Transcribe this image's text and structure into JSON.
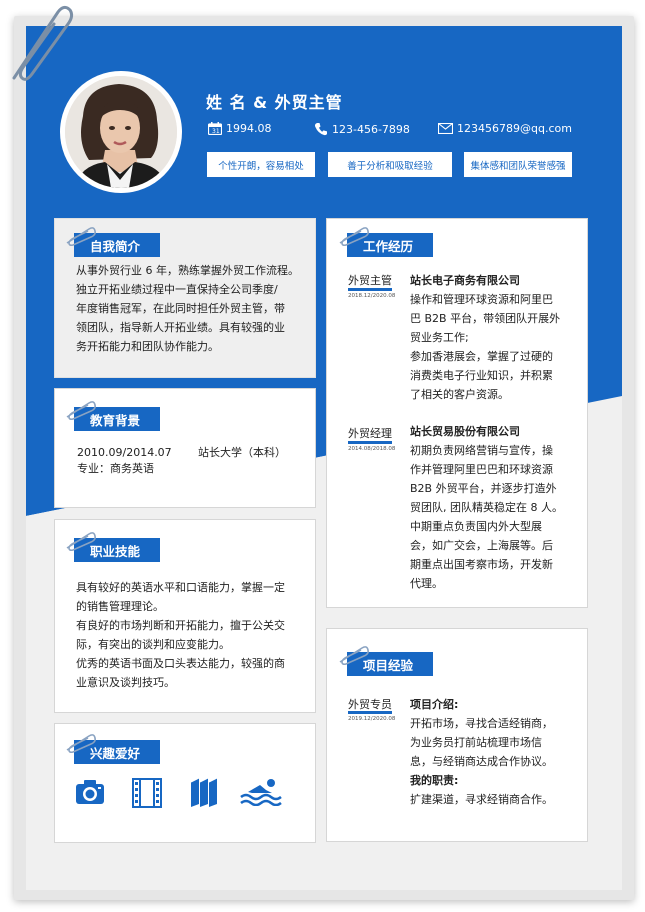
{
  "header": {
    "name_title": "姓 名 & 外贸主管",
    "birth": "1994.08",
    "phone": "123-456-7898",
    "email": "123456789@qq.com",
    "tags": [
      "个性开朗，容易相处",
      "善于分析和吸取经验",
      "集体感和团队荣誉感强"
    ]
  },
  "self_intro": {
    "title": "自我简介",
    "lines": [
      "从事外贸行业 6 年，熟练掌握外贸工作流程。",
      "独立开拓业绩过程中一直保持全公司季度/",
      "年度销售冠军，在此同时担任外贸主管，带",
      "领团队，指导新人开拓业绩。具有较强的业",
      "务开拓能力和团队协作能力。"
    ]
  },
  "education": {
    "title": "教育背景",
    "period": "2010.09/2014.07",
    "school": "站长大学（本科）",
    "major": "专业：商务英语"
  },
  "skills": {
    "title": "职业技能",
    "lines": [
      "具有较好的英语水平和口语能力，掌握一定",
      "的销售管理理论。",
      "有良好的市场判断和开拓能力，擅于公关交",
      "际，有突出的谈判和应变能力。",
      "优秀的英语书面及口头表达能力，较强的商",
      "业意识及谈判技巧。"
    ]
  },
  "hobbies": {
    "title": "兴趣爱好",
    "icons": [
      "camera-icon",
      "film-icon",
      "books-icon",
      "swimming-icon"
    ]
  },
  "work": {
    "title": "工作经历",
    "jobs": [
      {
        "role": "外贸主管",
        "date": "2018.12/2020.08",
        "company": "站长电子商务有限公司",
        "lines": [
          "操作和管理环球资源和阿里巴",
          "巴 B2B 平台，带领团队开展外",
          "贸业务工作;",
          "参加香港展会，掌握了过硬的",
          "消费类电子行业知识，并积累",
          "了相关的客户资源。"
        ]
      },
      {
        "role": "外贸经理",
        "date": "2014.08/2018.08",
        "company": "站长贸易股份有限公司",
        "lines": [
          "初期负责网络营销与宣传，操",
          "作并管理阿里巴巴和环球资源",
          "B2B 外贸平台，并逐步打造外",
          "贸团队, 团队精英稳定在 8 人。",
          "中期重点负责国内外大型展",
          "会，如广交会，上海展等。后",
          "期重点出国考察市场，开发新",
          "代理。"
        ]
      }
    ]
  },
  "project": {
    "title": "项目经验",
    "role": "外贸专员",
    "date": "2019.12/2020.08",
    "intro_label": "项目介绍:",
    "intro_lines": [
      "开拓市场，寻找合适经销商，",
      "为业务员打前站梳理市场信",
      "息，与经销商达成合作协议。"
    ],
    "duty_label": "我的职责:",
    "duty_lines": [
      "扩建渠道，寻求经销商合作。"
    ]
  },
  "colors": {
    "accent": "#1767c3",
    "card_gray": "#efefef"
  }
}
